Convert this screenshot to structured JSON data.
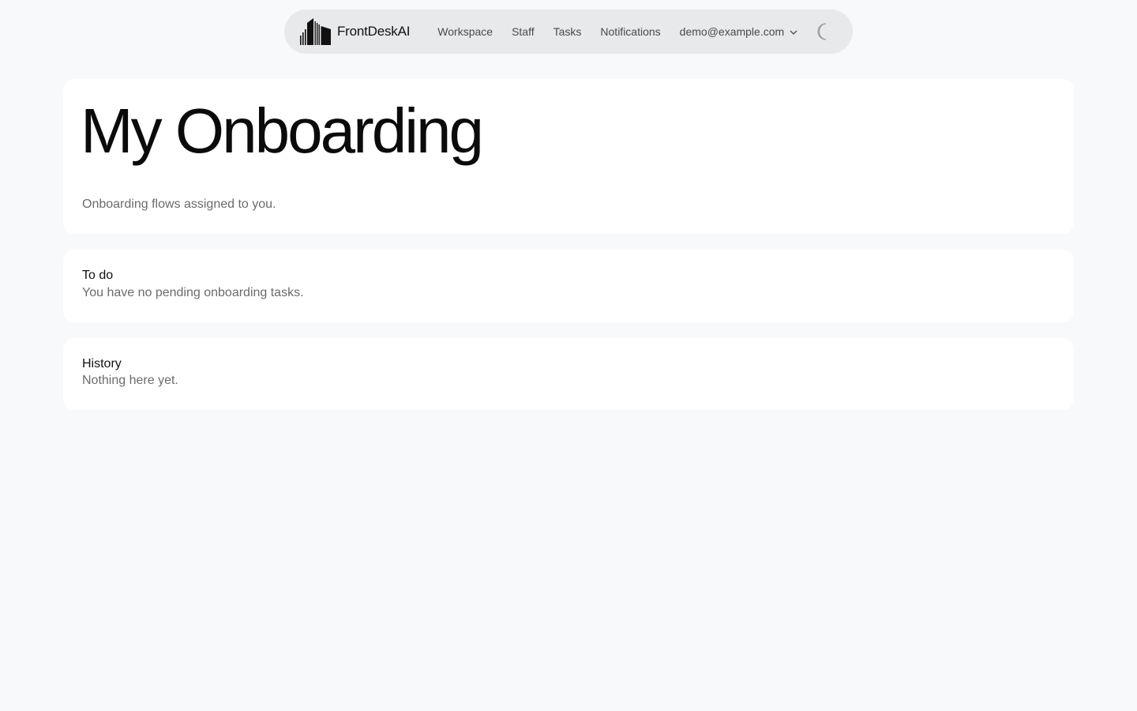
{
  "header": {
    "brand": {
      "name": "FrontDeskAI",
      "icon": "buildings-logo-icon"
    },
    "nav": [
      {
        "label": "Workspace"
      },
      {
        "label": "Staff"
      },
      {
        "label": "Tasks"
      },
      {
        "label": "Notifications"
      }
    ],
    "account": {
      "email": "demo@example.com",
      "icon": "chevron-down-icon"
    },
    "theme_toggle": {
      "icon": "moon-icon"
    }
  },
  "page": {
    "title": "My Onboarding",
    "subtitle": "Onboarding flows assigned to you."
  },
  "sections": {
    "todo": {
      "title": "To do",
      "empty_text": "You have no pending onboarding tasks."
    },
    "history": {
      "title": "History",
      "empty_text": "Nothing here yet."
    }
  },
  "colors": {
    "background": "#f8f9fa",
    "card": "#ffffff",
    "topbar": "#e8e9eb",
    "text_primary": "#0b0b0b",
    "text_muted": "#6b6b6b"
  }
}
